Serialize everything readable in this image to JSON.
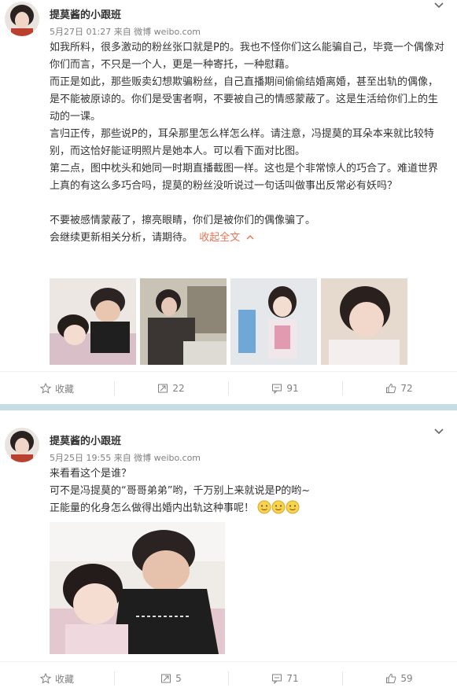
{
  "posts": [
    {
      "author": "提莫酱的小跟班",
      "meta": "5月27日 01:27 来自 微博 weibo.com",
      "paragraphs": [
        "如我所料，很多激动的粉丝张口就是P的。我也不怪你们这么能骗自己，毕竟一个偶像对你们而言，不只是一个人，更是一种寄托，一种慰藉。",
        "而正是如此，那些贩卖幻想欺骗粉丝，自己直播期间偷偷结婚离婚，甚至出轨的偶像，是不能被原谅的。你们是受害者啊，不要被自己的情感蒙蔽了。这是生活给你们上的生动的一课。",
        "言归正传，那些说P的，耳朵那里怎么样怎么样。请注意，冯提莫的耳朵本来就比较特别，而这恰好能证明照片是她本人。可以看下面对比图。",
        "第二点，图中枕头和她同一时期直播截图一样。这也是个非常惊人的巧合了。难道世界上真的有这么多巧合吗，提莫的粉丝没听说过一句话叫做事出反常必有妖吗？",
        "",
        "不要被感情蒙蔽了，擦亮眼睛，你们是被你们的偶像骗了。"
      ],
      "last_line": "会继续更新相关分析，请期待。",
      "collapse_label": "收起全文",
      "actions": {
        "favorite": "收藏",
        "repost": "22",
        "comment": "91",
        "like": "72"
      }
    },
    {
      "author": "提莫酱的小跟班",
      "meta": "5月25日 19:55 来自 微博 weibo.com",
      "lines": [
        "来看看这个是谁？",
        "可不是冯提莫的“哥哥弟弟”哟，千万别上来就说是P的哟~",
        "正能量的化身怎么做得出婚内出轨这种事呢！"
      ],
      "actions": {
        "favorite": "收藏",
        "repost": "5",
        "comment": "71",
        "like": "59"
      }
    }
  ],
  "icons": [
    "avatar",
    "chevron-down-icon",
    "star-icon",
    "repost-icon",
    "comment-icon",
    "thumbs-up-icon",
    "emoji-icon"
  ],
  "colors": {
    "accent": "#eb7350",
    "divider": "#c6dde6",
    "meta": "#808080"
  }
}
